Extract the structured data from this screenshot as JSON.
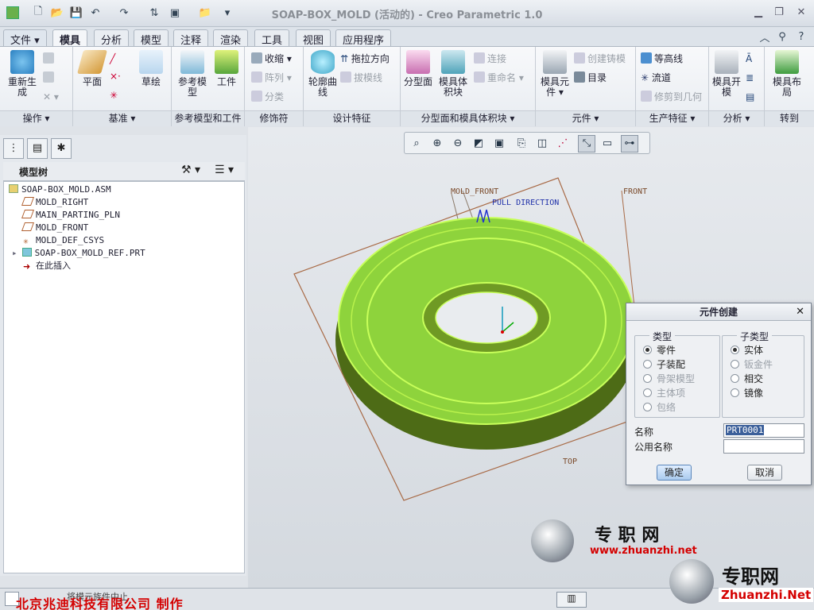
{
  "window": {
    "title": "SOAP-BOX_MOLD (活动的) - Creo Parametric 1.0"
  },
  "tabs": [
    "文件 ▾",
    "模具",
    "分析",
    "模型",
    "注释",
    "渲染",
    "工具",
    "视图",
    "应用程序"
  ],
  "ribbon": {
    "ops": {
      "regen": "重新生成",
      "label": "操作 ▾"
    },
    "datum": {
      "plane": "平面",
      "sketch": "草绘",
      "label": "基准 ▾"
    },
    "ref": {
      "refmodel": "参考模型",
      "workpiece": "工件",
      "label": "参考模型和工件"
    },
    "decor": {
      "shrink": "收缩",
      "array": "阵列",
      "classify": "分类",
      "label": "修饰符"
    },
    "design": {
      "silhouette": "轮廓曲线",
      "pull": "拖拉方向",
      "draft": "拔模线",
      "label": "设计特征"
    },
    "parting": {
      "partsurf": "分型面",
      "volume": "模具体积块",
      "connect": "连接",
      "rename": "重命名",
      "label": "分型面和模具体积块 ▾"
    },
    "comp": {
      "moldcomp": "模具元件",
      "casting": "创建铸模",
      "catalog": "目录",
      "label": "元件 ▾"
    },
    "prod": {
      "contour": "等高线",
      "flow": "流道",
      "trim": "修剪到几何",
      "label": "生产特征 ▾"
    },
    "analysis": {
      "open": "模具开模",
      "label": "分析 ▾"
    },
    "goto": {
      "layout": "模具布局",
      "label": "转到"
    }
  },
  "tree": {
    "title": "模型树",
    "nodes": [
      "SOAP-BOX_MOLD.ASM",
      "MOLD_RIGHT",
      "MAIN_PARTING_PLN",
      "MOLD_FRONT",
      "MOLD_DEF_CSYS",
      "SOAP-BOX_MOLD_REF.PRT",
      "在此插入"
    ]
  },
  "viewport": {
    "labels": {
      "mold_front": "MOLD_FRONT",
      "front": "FRONT",
      "pull": "PULL DIRECTION",
      "top": "TOP"
    }
  },
  "dialog": {
    "title": "元件创建",
    "type_label": "类型",
    "types": [
      "零件",
      "子装配",
      "骨架模型",
      "主体项",
      "包络"
    ],
    "subtype_label": "子类型",
    "subtypes": [
      "实体",
      "钣金件",
      "相交",
      "镜像"
    ],
    "name_label": "名称",
    "name_value": "PRT0001",
    "common_label": "公用名称",
    "ok": "确定",
    "cancel": "取消"
  },
  "status": {
    "msg": "将模元族件中止",
    "maker": "北京兆迪科技有限公司 制作"
  },
  "watermark": {
    "logo": "专 职 网",
    "url": "www.zhuanzhi.net",
    "logo2": "专职网",
    "url2": "Zhuanzhi.Net"
  },
  "colors": {
    "accent": "#8ed33c",
    "ribbonbg": "#eef1f5",
    "brand_red": "#d40000"
  }
}
